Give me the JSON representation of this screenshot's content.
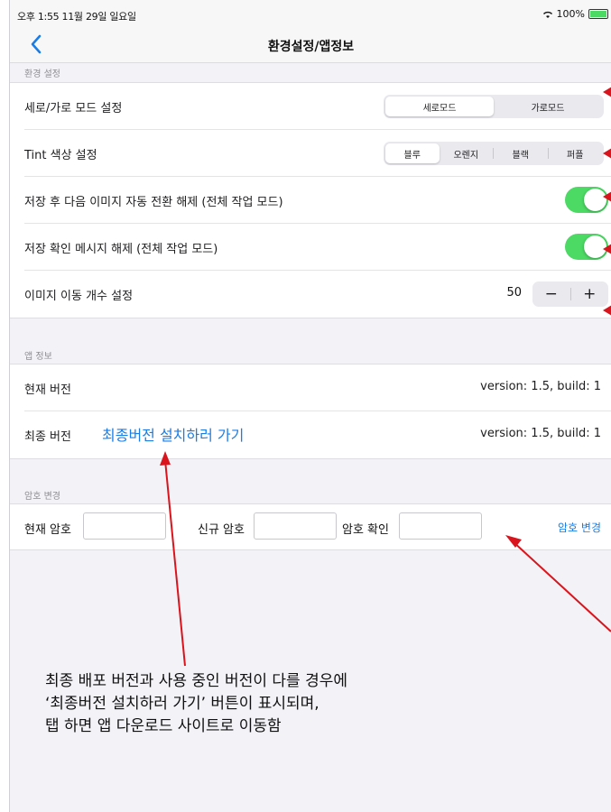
{
  "status_bar": {
    "time": "오후 1:55   11월 29일 일요일",
    "battery": "100%"
  },
  "nav": {
    "title": "환경설정/앱정보"
  },
  "env_section": {
    "header": "환경 설정",
    "orientation": {
      "label": "세로/가로 모드 설정",
      "options": [
        "세로모드",
        "가로모드"
      ],
      "selected": "세로모드"
    },
    "tint": {
      "label": "Tint 색상 설정",
      "options": [
        "블루",
        "오렌지",
        "블랙",
        "퍼플"
      ],
      "selected": "블루"
    },
    "auto_switch": {
      "label": "저장 후 다음 이미지 자동 전환 해제 (전체 작업 모드)",
      "on": true
    },
    "save_confirm": {
      "label": "저장 확인 메시지 해제 (전체 작업 모드)",
      "on": true
    },
    "move_count": {
      "label": "이미지 이동 개수 설정",
      "value": "50",
      "minus": "−",
      "plus": "+"
    }
  },
  "app_section": {
    "header": "앱 정보",
    "current": {
      "label": "현재 버전",
      "value": "version: 1.5, build: 1"
    },
    "latest": {
      "label": "최종 버전",
      "link": "최종버전 설치하러 가기",
      "value": "version: 1.5, build: 1"
    }
  },
  "pw_section": {
    "header": "암호 변경",
    "current_label": "현재 암호",
    "new_label": "신규 암호",
    "confirm_label": "암호 확인",
    "button": "암호 변경"
  },
  "annotation": {
    "line1": "최종 배포 버전과 사용 중인 버전이 다를 경우에",
    "line2": "‘최종버전 설치하러 가기’ 버튼이 표시되며,",
    "line3": "탭 하면 앱 다운로드 사이트로 이동함"
  },
  "colors": {
    "accent": "#1a7de6",
    "toggle_on": "#4cd964",
    "annotation_red": "#d9141c"
  }
}
